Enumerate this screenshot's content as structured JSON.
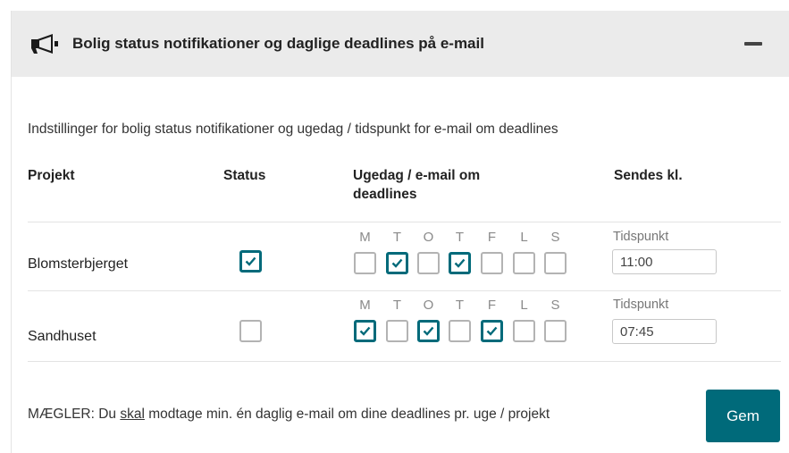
{
  "panel": {
    "title": "Bolig status notifikationer og daglige deadlines på e-mail",
    "header_icon": "megaphone-icon",
    "collapse_icon": "minus-icon",
    "accent_color": "#006a7a",
    "header_bg": "#ebebeb"
  },
  "description": "Indstillinger for bolig status notifikationer og ugedag / tidspunkt for e-mail om deadlines",
  "table": {
    "headers": {
      "project": "Projekt",
      "status": "Status",
      "weekday_line1": "Ugedag / e-mail om",
      "weekday_line2": "deadlines",
      "send_time": "Sendes kl."
    },
    "day_letters": [
      "M",
      "T",
      "O",
      "T",
      "F",
      "L",
      "S"
    ],
    "time_label": "Tidspunkt",
    "rows": [
      {
        "project": "Blomsterbjerget",
        "status_checked": true,
        "days": [
          false,
          true,
          false,
          true,
          false,
          false,
          false
        ],
        "time": "11:00"
      },
      {
        "project": "Sandhuset",
        "status_checked": false,
        "days": [
          true,
          false,
          true,
          false,
          true,
          false,
          false
        ],
        "time": "07:45"
      }
    ]
  },
  "note": {
    "before": "MÆGLER: Du ",
    "emphasis": "skal",
    "after": " modtage min. én daglig e-mail om dine deadlines pr. uge / projekt"
  },
  "save_label": "Gem"
}
